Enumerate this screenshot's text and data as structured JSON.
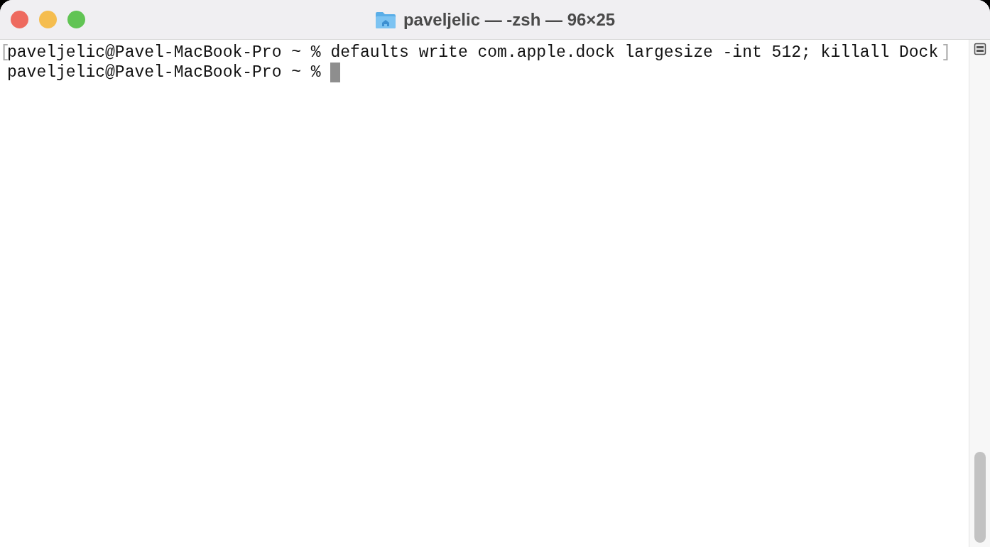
{
  "window": {
    "title": "paveljelic — -zsh — 96×25"
  },
  "terminal": {
    "lines": [
      {
        "left_mark": "[",
        "text": "paveljelic@Pavel-MacBook-Pro ~ % defaults write com.apple.dock largesize -int 512; killall Dock",
        "right_mark": "]",
        "cursor": false
      },
      {
        "text": "paveljelic@Pavel-MacBook-Pro ~ % ",
        "cursor": true
      }
    ]
  }
}
